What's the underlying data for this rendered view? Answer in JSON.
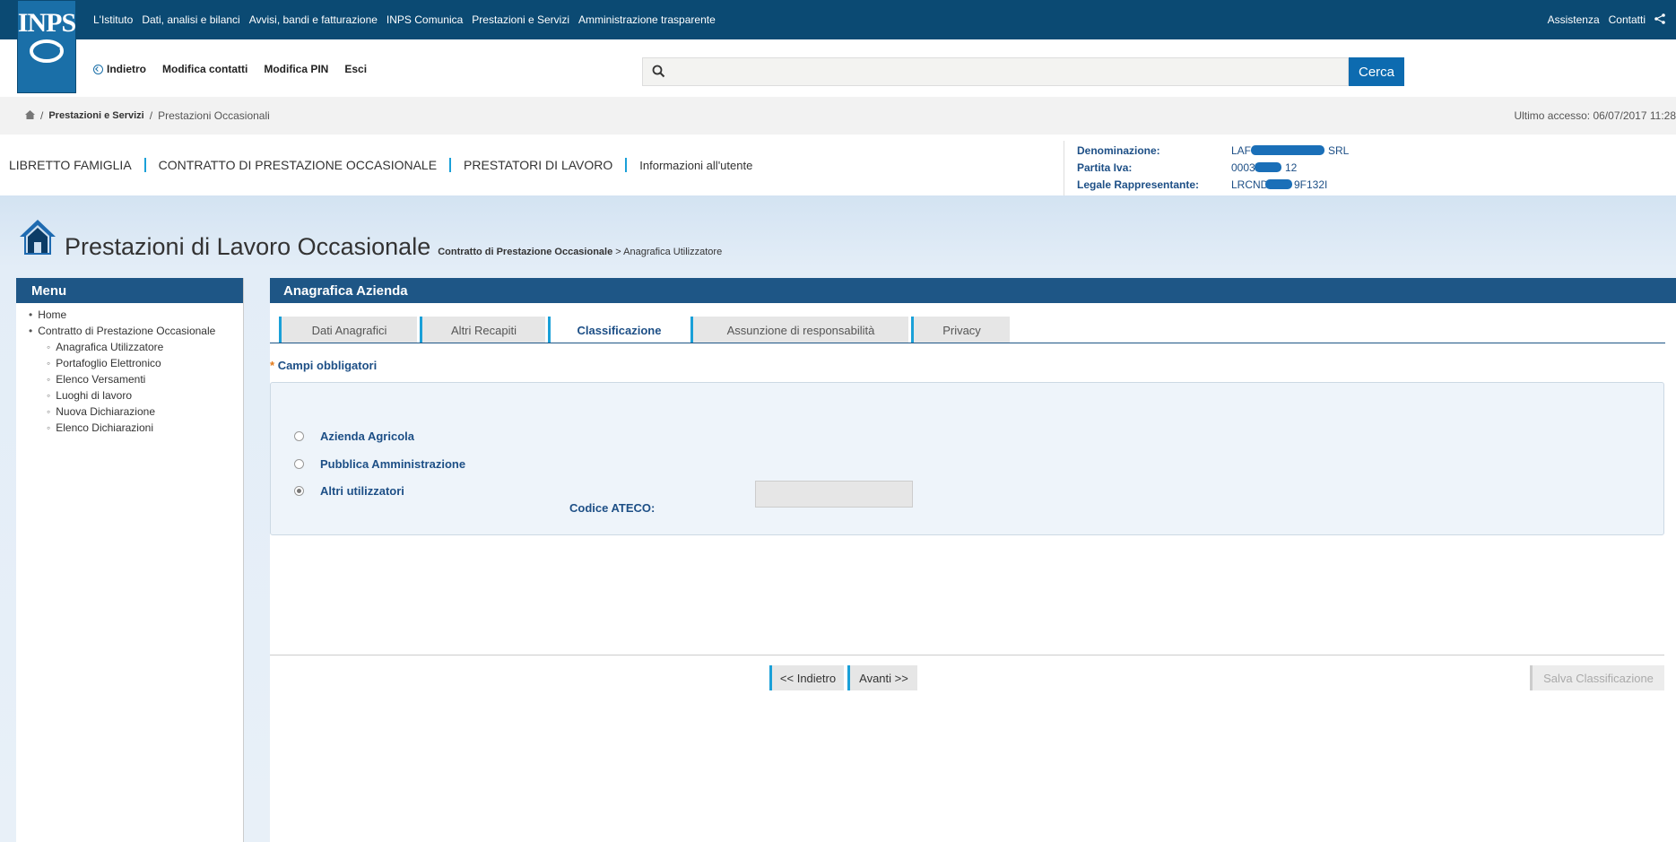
{
  "logo": {
    "text": "INPS"
  },
  "topnav": {
    "items": [
      "L'Istituto",
      "Dati, analisi e bilanci",
      "Avvisi, bandi e fatturazione",
      "INPS Comunica",
      "Prestazioni e Servizi",
      "Amministrazione trasparente"
    ],
    "right": [
      "Assistenza",
      "Contatti"
    ]
  },
  "row2": {
    "back": "Indietro",
    "links": [
      "Modifica contatti",
      "Modifica PIN",
      "Esci"
    ],
    "search_placeholder": "",
    "search_button": "Cerca"
  },
  "breadcrumb": {
    "items": [
      "Prestazioni e Servizi",
      "Prestazioni Occasionali"
    ],
    "last_access": "Ultimo accesso: 06/07/2017 11:28"
  },
  "service_nav": {
    "items": [
      "LIBRETTO FAMIGLIA",
      "CONTRATTO DI PRESTAZIONE OCCASIONALE",
      "PRESTATORI DI LAVORO",
      "Informazioni all'utente"
    ]
  },
  "company": {
    "denominazione_label": "Denominazione:",
    "denominazione_value_start": "LAF",
    "denominazione_value_end": "SRL",
    "piva_label": "Partita Iva:",
    "piva_value_start": "0003",
    "piva_value_end": "12",
    "legale_label": "Legale Rappresentante:",
    "legale_value_start": "LRCND",
    "legale_value_end": "9F132I"
  },
  "page": {
    "title": "Prestazioni di Lavoro Occasionale",
    "sub_bold": "Contratto di Prestazione Occasionale",
    "sub_rest": " > Anagrafica Utilizzatore"
  },
  "menu": {
    "title": "Menu",
    "home": "Home",
    "contratto": "Contratto di Prestazione Occasionale",
    "subitems": [
      "Anagrafica Utilizzatore",
      "Portafoglio Elettronico",
      "Elenco Versamenti",
      "Luoghi di lavoro",
      "Nuova Dichiarazione",
      "Elenco Dichiarazioni"
    ]
  },
  "panel": {
    "title": "Anagrafica Azienda",
    "tabs": [
      "Dati Anagrafici",
      "Altri Recapiti",
      "Classificazione",
      "Assunzione di responsabilità",
      "Privacy"
    ],
    "active_tab": "Classificazione",
    "required_mark": "*",
    "required_text": "Campi obbligatori",
    "options": [
      "Azienda Agricola",
      "Pubblica Amministrazione",
      "Altri utilizzatori"
    ],
    "selected_option": "Altri utilizzatori",
    "ateco_label": "Codice ATECO:",
    "ateco_value": "",
    "btn_back": "<< Indietro",
    "btn_next": "Avanti >>",
    "btn_save": "Salva Classificazione"
  },
  "colors": {
    "topbar": "#0b4a73",
    "header_blue": "#1e5686",
    "accent": "#1aa0d8",
    "search_button": "#0d6bb0"
  }
}
